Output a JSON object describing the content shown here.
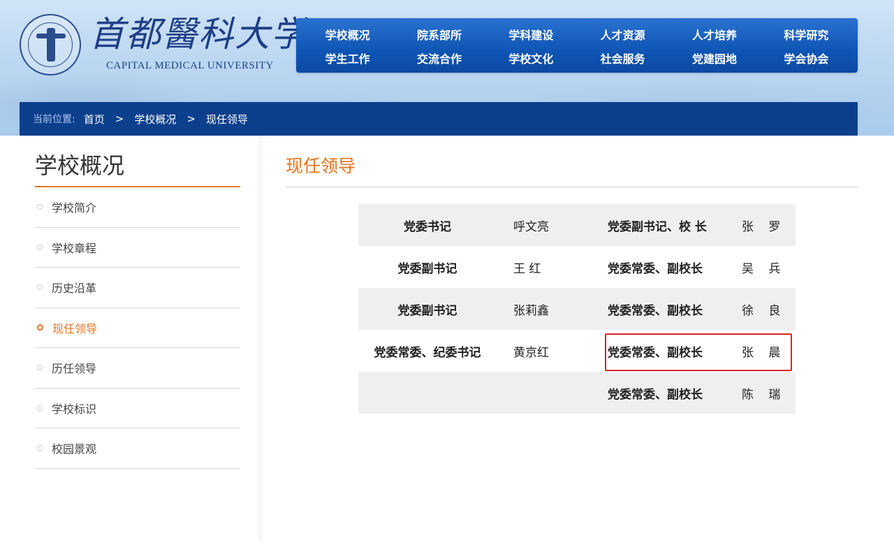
{
  "header": {
    "logo_cn": "首都醫科大学",
    "logo_en": "CAPITAL MEDICAL UNIVERSITY",
    "nav": [
      "学校概况",
      "院系部所",
      "学科建设",
      "人才资源",
      "人才培养",
      "科学研究",
      "学生工作",
      "交流合作",
      "学校文化",
      "社会服务",
      "党建园地",
      "学会协会"
    ]
  },
  "breadcrumb": {
    "label": "当前位置:",
    "items": [
      "首页",
      "学校概况",
      "现任领导"
    ],
    "separator": ">"
  },
  "sidebar": {
    "title": "学校概况",
    "items": [
      "学校简介",
      "学校章程",
      "历史沿革",
      "现任领导",
      "历任领导",
      "学校标识",
      "校园景观"
    ],
    "active_index": 3
  },
  "main": {
    "title": "现任领导",
    "rows": [
      {
        "role1": "党委书记",
        "name1": "呼文亮",
        "role2": "党委副书记、校 长",
        "name2": "张 罗"
      },
      {
        "role1": "党委副书记",
        "name1": "王 红",
        "role2": "党委常委、副校长",
        "name2": "吴 兵"
      },
      {
        "role1": "党委副书记",
        "name1": "张莉鑫",
        "role2": "党委常委、副校长",
        "name2": "徐 良"
      },
      {
        "role1": "党委常委、纪委书记",
        "name1": "黄京红",
        "role2": "党委常委、副校长",
        "name2": "张 晨"
      },
      {
        "role1": "",
        "name1": "",
        "role2": "党委常委、副校长",
        "name2": "陈 瑞"
      }
    ]
  },
  "colors": {
    "accent_orange": "#e8741e",
    "nav_blue": "#0f55b4",
    "crumb_blue": "#0c3f8c",
    "highlight_red": "#d3262b"
  }
}
